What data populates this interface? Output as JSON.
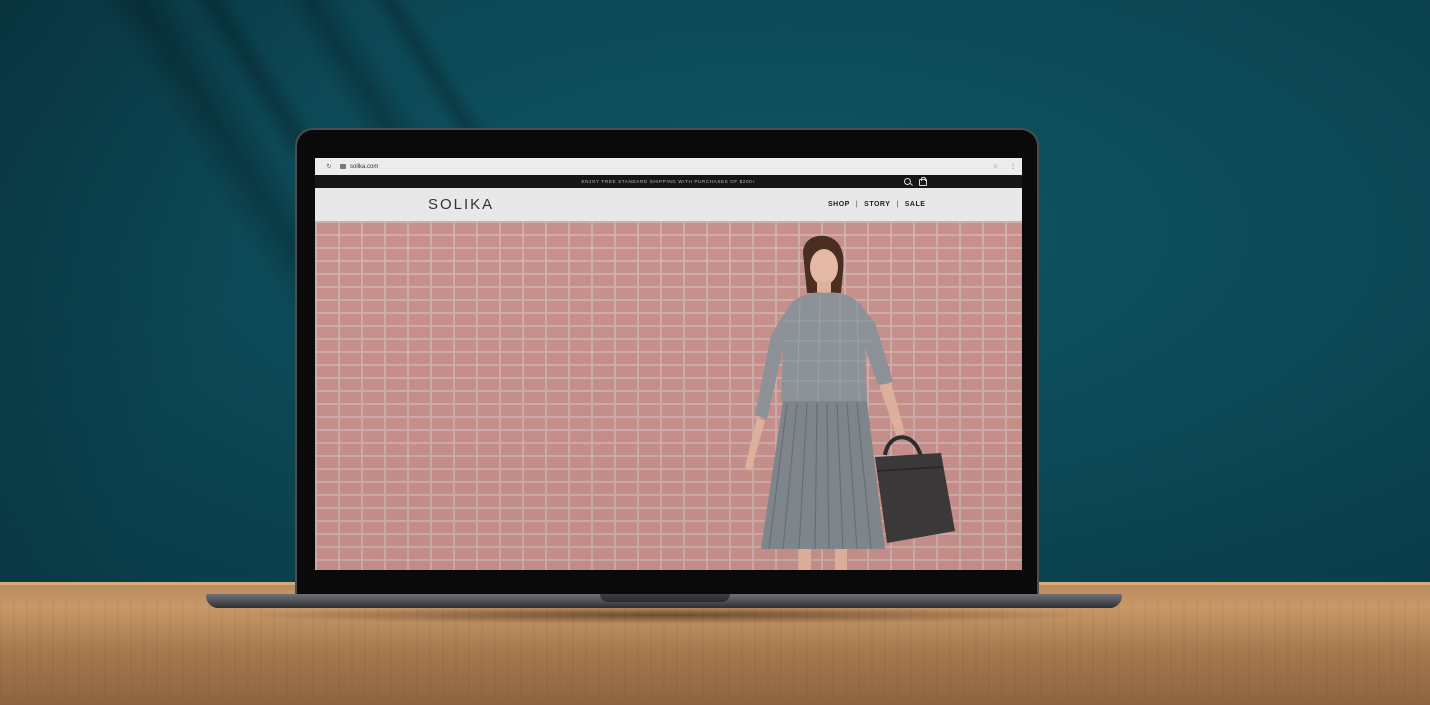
{
  "browser": {
    "url": "solika.com",
    "reload_icon": "reload-icon",
    "star_icon": "star-icon",
    "menu_icon": "menu-icon"
  },
  "promo": {
    "text": "ENJOY FREE STANDARD SHIPPING WITH PURCHASES OF $200+"
  },
  "header": {
    "logo": "SOLIKA",
    "nav": [
      {
        "label": "SHOP"
      },
      {
        "label": "STORY"
      },
      {
        "label": "SALE"
      }
    ],
    "separator": "|"
  },
  "colors": {
    "wall": "#0c4755",
    "brick": "#c99591",
    "mortar": "#d2bcba",
    "promo_bar": "#161616",
    "header_bg": "#e8e8e8",
    "table": "#b88a5c"
  },
  "icons": [
    "search-icon",
    "bag-icon"
  ]
}
